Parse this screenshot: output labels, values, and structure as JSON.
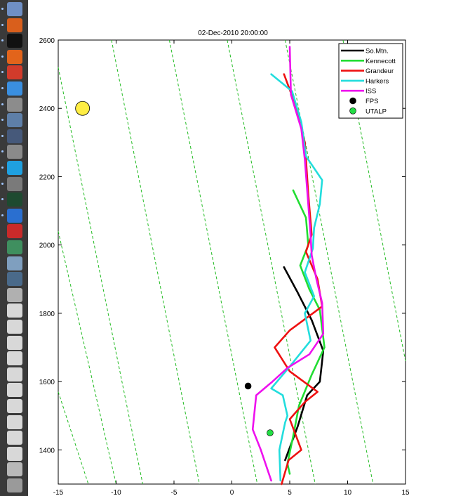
{
  "dock": {
    "icons": [
      {
        "name": "preview-app-icon",
        "color": "#6f8fc4"
      },
      {
        "name": "matlab-icon",
        "color": "#d95f1c"
      },
      {
        "name": "terminal-icon",
        "color": "#111111"
      },
      {
        "name": "firefox-icon",
        "color": "#e2641b"
      },
      {
        "name": "calendar-icon",
        "color": "#d23b2b"
      },
      {
        "name": "itunes-icon",
        "color": "#3a8fe0"
      },
      {
        "name": "system-preferences-icon",
        "color": "#8c8c8c"
      },
      {
        "name": "dashboard-icon",
        "color": "#5e7fa8"
      },
      {
        "name": "idv-icon",
        "color": "#46597a"
      },
      {
        "name": "utility-icon",
        "color": "#8a8a8a"
      },
      {
        "name": "skype-icon",
        "color": "#1fa0e0"
      },
      {
        "name": "user-app-icon",
        "color": "#7a7a7a"
      },
      {
        "name": "activity-monitor-icon",
        "color": "#1e4a30"
      },
      {
        "name": "word-icon",
        "color": "#2a6fd0"
      },
      {
        "name": "acrobat-icon",
        "color": "#c92a2a"
      },
      {
        "name": "mail-icon",
        "color": "#3f8f5f"
      },
      {
        "name": "image-capture-icon",
        "color": "#7f9fbf"
      },
      {
        "name": "facetime-icon",
        "color": "#4a6a8a"
      },
      {
        "name": "script-editor-icon",
        "color": "#b0b0b0"
      },
      {
        "name": "document-icon-1",
        "color": "#d8d8d8"
      },
      {
        "name": "document-icon-2",
        "color": "#d8d8d8"
      },
      {
        "name": "document-icon-3",
        "color": "#d8d8d8"
      },
      {
        "name": "document-icon-4",
        "color": "#d8d8d8"
      },
      {
        "name": "document-icon-5",
        "color": "#d8d8d8"
      },
      {
        "name": "document-icon-6",
        "color": "#d8d8d8"
      },
      {
        "name": "document-icon-7",
        "color": "#d8d8d8"
      },
      {
        "name": "document-icon-8",
        "color": "#d8d8d8"
      },
      {
        "name": "document-icon-9",
        "color": "#d8d8d8"
      },
      {
        "name": "document-icon-10",
        "color": "#d8d8d8"
      },
      {
        "name": "downloads-icon",
        "color": "#b8b8b8"
      },
      {
        "name": "trash-icon",
        "color": "#9a9a9a"
      }
    ]
  },
  "chart_data": {
    "type": "line",
    "title": "02-Dec-2010 20:00:00",
    "xlim": [
      -15,
      15
    ],
    "ylim": [
      1300,
      2600
    ],
    "xticks": [
      "-15",
      "-10",
      "-5",
      "0",
      "5",
      "10",
      "15"
    ],
    "yticks": [
      "1400",
      "1600",
      "1800",
      "2000",
      "2200",
      "2400",
      "2600"
    ],
    "grid": false,
    "legend_position": "top-right",
    "series": [
      {
        "name": "So.Mtn.",
        "color": "#000000",
        "kind": "line",
        "points": [
          [
            4.6,
            1370
          ],
          [
            5.7,
            1470
          ],
          [
            6.5,
            1560
          ],
          [
            7.6,
            1600
          ],
          [
            7.9,
            1690
          ],
          [
            6.9,
            1780
          ],
          [
            5.7,
            1860
          ],
          [
            4.5,
            1935
          ]
        ]
      },
      {
        "name": "Kennecott",
        "color": "#22dd33",
        "kind": "line",
        "points": [
          [
            5.0,
            1330
          ],
          [
            4.8,
            1360
          ],
          [
            5.3,
            1440
          ],
          [
            5.8,
            1530
          ],
          [
            6.9,
            1620
          ],
          [
            8.0,
            1700
          ],
          [
            7.6,
            1810
          ],
          [
            6.7,
            1870
          ],
          [
            5.9,
            1940
          ],
          [
            6.6,
            2000
          ],
          [
            6.4,
            2080
          ],
          [
            5.3,
            2160
          ]
        ]
      },
      {
        "name": "Grandeur",
        "color": "#ee1111",
        "kind": "line",
        "points": [
          [
            4.3,
            1300
          ],
          [
            4.9,
            1370
          ],
          [
            6.0,
            1400
          ],
          [
            5.0,
            1490
          ],
          [
            6.3,
            1540
          ],
          [
            7.4,
            1570
          ],
          [
            5.0,
            1630
          ],
          [
            3.7,
            1700
          ],
          [
            5.0,
            1750
          ],
          [
            7.8,
            1820
          ],
          [
            7.4,
            1900
          ],
          [
            6.4,
            1980
          ],
          [
            6.9,
            2030
          ],
          [
            6.6,
            2150
          ],
          [
            6.3,
            2300
          ],
          [
            5.6,
            2400
          ],
          [
            4.5,
            2500
          ]
        ]
      },
      {
        "name": "Harkers",
        "color": "#22dddd",
        "kind": "line",
        "points": [
          [
            4.2,
            1310
          ],
          [
            4.1,
            1400
          ],
          [
            4.6,
            1480
          ],
          [
            4.8,
            1500
          ],
          [
            4.4,
            1560
          ],
          [
            3.4,
            1580
          ],
          [
            4.9,
            1640
          ],
          [
            6.8,
            1720
          ],
          [
            6.3,
            1800
          ],
          [
            7.1,
            1850
          ],
          [
            6.3,
            1920
          ],
          [
            7.0,
            1990
          ],
          [
            7.1,
            2050
          ],
          [
            7.6,
            2120
          ],
          [
            7.8,
            2190
          ],
          [
            6.4,
            2260
          ],
          [
            6.0,
            2360
          ],
          [
            5.2,
            2450
          ],
          [
            3.4,
            2500
          ]
        ]
      },
      {
        "name": "ISS",
        "color": "#ee11ee",
        "kind": "line",
        "points": [
          [
            3.4,
            1310
          ],
          [
            2.5,
            1400
          ],
          [
            1.8,
            1460
          ],
          [
            2.1,
            1560
          ],
          [
            3.5,
            1600
          ],
          [
            4.8,
            1640
          ],
          [
            6.7,
            1680
          ],
          [
            7.9,
            1740
          ],
          [
            7.8,
            1830
          ],
          [
            7.3,
            1900
          ],
          [
            6.9,
            1970
          ],
          [
            6.8,
            2030
          ],
          [
            6.6,
            2120
          ],
          [
            6.3,
            2250
          ],
          [
            6.0,
            2340
          ],
          [
            5.1,
            2440
          ],
          [
            5.0,
            2580
          ]
        ]
      },
      {
        "name": "FPS",
        "color": "#000000",
        "kind": "point",
        "points": [
          [
            1.4,
            1587
          ]
        ]
      },
      {
        "name": "UTALP",
        "color": "#22dd44",
        "kind": "point",
        "points": [
          [
            3.3,
            1450
          ]
        ]
      }
    ],
    "marker_yellow": {
      "x": -12.9,
      "y": 2400,
      "color": "#ffee44"
    },
    "guide_lines": {
      "color": "#22bb22",
      "segments": [
        [
          [
            -15,
            2520
          ],
          [
            -7.7,
            1300
          ]
        ],
        [
          [
            -15,
            2040
          ],
          [
            -10.0,
            1300
          ]
        ],
        [
          [
            -15,
            1570
          ],
          [
            -12.4,
            1300
          ]
        ],
        [
          [
            -10.4,
            2600
          ],
          [
            -2.8,
            1300
          ]
        ],
        [
          [
            -5.4,
            2600
          ],
          [
            2.2,
            1300
          ]
        ],
        [
          [
            -0.4,
            2600
          ],
          [
            7.2,
            1300
          ]
        ],
        [
          [
            4.6,
            2600
          ],
          [
            12.2,
            1300
          ]
        ],
        [
          [
            9.6,
            2600
          ],
          [
            15.0,
            1660
          ]
        ]
      ]
    }
  }
}
